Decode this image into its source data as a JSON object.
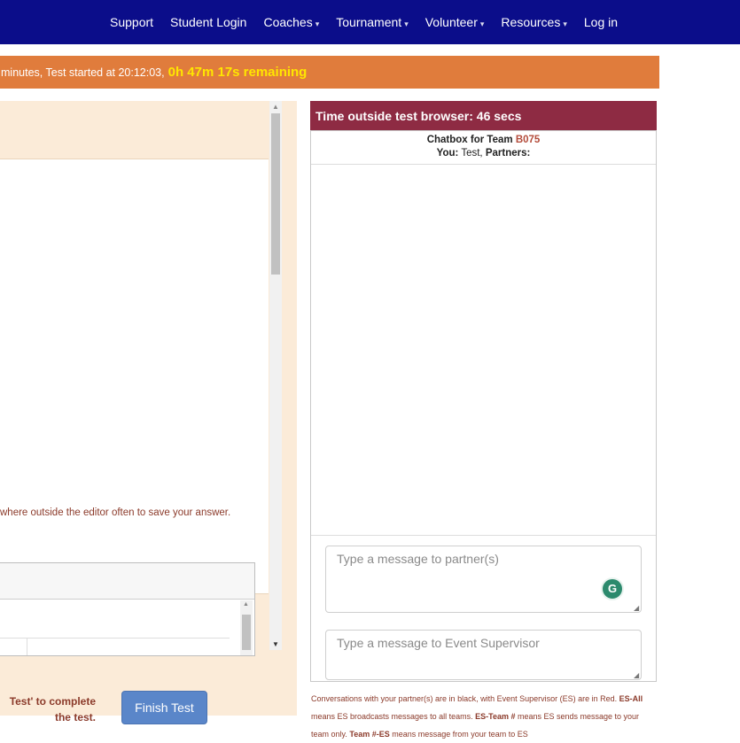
{
  "nav": {
    "items": [
      {
        "label": "Support",
        "caret": ""
      },
      {
        "label": "Student Login",
        "caret": ""
      },
      {
        "label": "Coaches",
        "caret": "▾"
      },
      {
        "label": "Tournament",
        "caret": "▾"
      },
      {
        "label": "Volunteer",
        "caret": "▾"
      },
      {
        "label": "Resources",
        "caret": "▾"
      },
      {
        "label": "Log in",
        "caret": ""
      }
    ]
  },
  "timer": {
    "prefix": "minutes, Test started at 20:12:03,",
    "remaining": "0h 47m 17s remaining"
  },
  "question": {
    "save_note": "where outside the editor often to save your answer.",
    "finish_instruction_line1": "Test' to complete",
    "finish_instruction_line2": "the test.",
    "finish_button": "Finish Test"
  },
  "chat": {
    "time_outside": "Time outside test browser: 46 secs",
    "header_prefix": "Chatbox for Team",
    "team_code": "B075",
    "you_label": "You:",
    "you_value": "Test,",
    "partners_label": "Partners:",
    "partner_placeholder": "Type a message to partner(s)",
    "es_placeholder": "Type a message to Event Supervisor",
    "grammarly_letter": "G",
    "legend": {
      "l1": "Conversations with your partner(s) are in black, with Event Supervisor (ES) are in Red.",
      "es_all": "ES-All",
      "l2": "means ES broadcasts messages to all teams.",
      "es_team": "ES-Team #",
      "l3": "means ES sends message to your team only.",
      "team_es": "Team #-ES",
      "l4": "means message from your team to ES"
    }
  },
  "colors": {
    "navbar": "#0b0d8a",
    "timer_bar": "#e07c3c",
    "timer_highlight": "#ffe600",
    "time_outside_bar": "#8e2b43",
    "finish_button": "#5a86c9",
    "panel_bg": "#fbebd8"
  }
}
